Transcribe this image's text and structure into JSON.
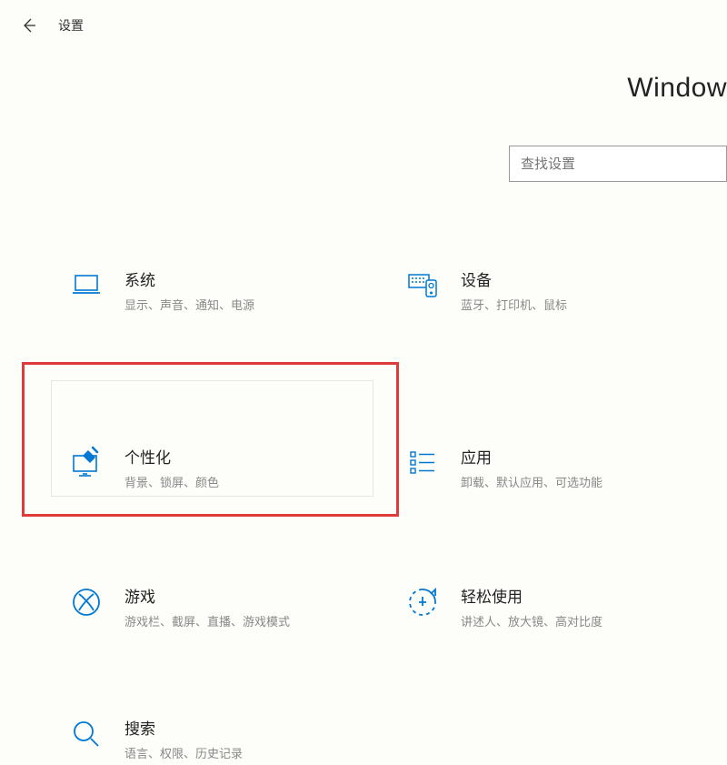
{
  "header": {
    "title": "设置"
  },
  "brand": "Window",
  "search": {
    "placeholder": "查找设置"
  },
  "tiles": {
    "system": {
      "title": "系统",
      "desc": "显示、声音、通知、电源"
    },
    "devices": {
      "title": "设备",
      "desc": "蓝牙、打印机、鼠标"
    },
    "personalize": {
      "title": "个性化",
      "desc": "背景、锁屏、颜色"
    },
    "apps": {
      "title": "应用",
      "desc": "卸载、默认应用、可选功能"
    },
    "gaming": {
      "title": "游戏",
      "desc": "游戏栏、截屏、直播、游戏模式"
    },
    "ease": {
      "title": "轻松使用",
      "desc": "讲述人、放大镜、高对比度"
    },
    "search": {
      "title": "搜索",
      "desc": "语言、权限、历史记录"
    }
  },
  "colors": {
    "accent": "#0078d4"
  }
}
